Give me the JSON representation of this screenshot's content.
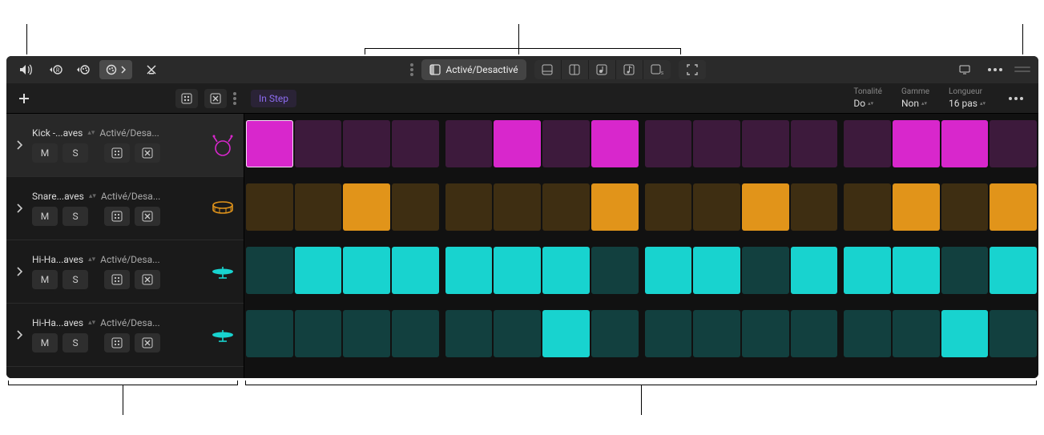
{
  "toolbar": {
    "edit_toggle_label": "Activé/Desactivé"
  },
  "subbar": {
    "in_step_label": "In Step",
    "params": [
      {
        "label": "Tonalité",
        "value": "Do"
      },
      {
        "label": "Gamme",
        "value": "Non"
      },
      {
        "label": "Longueur",
        "value": "16 pas"
      }
    ]
  },
  "track_common": {
    "mute_label": "M",
    "solo_label": "S",
    "status_label": "Activé/Desa..."
  },
  "tracks": [
    {
      "name": "Kick -...aves",
      "icon": "kick",
      "color_on": "#d827cc",
      "color_off": "#3d1a3c"
    },
    {
      "name": "Snare...aves",
      "icon": "snare",
      "color_on": "#e1941a",
      "color_off": "#3e2e12"
    },
    {
      "name": "Hi-Ha...aves",
      "icon": "hihat",
      "color_on": "#18d3cf",
      "color_off": "#12403f"
    },
    {
      "name": "Hi-Ha...aves",
      "icon": "hihat",
      "color_on": "#18d3cf",
      "color_off": "#12403f"
    }
  ],
  "chart_data": {
    "type": "table",
    "steps": 16,
    "rows": [
      {
        "track": "Kick",
        "pattern": [
          1,
          0,
          0,
          0,
          0,
          1,
          0,
          1,
          0,
          0,
          0,
          0,
          0,
          1,
          1,
          0
        ]
      },
      {
        "track": "Snare",
        "pattern": [
          0,
          0,
          1,
          0,
          0,
          0,
          0,
          1,
          0,
          0,
          1,
          0,
          0,
          1,
          0,
          1
        ]
      },
      {
        "track": "Hi-Hat",
        "pattern": [
          0,
          1,
          1,
          1,
          1,
          1,
          1,
          0,
          1,
          1,
          0,
          1,
          1,
          1,
          0,
          1
        ]
      },
      {
        "track": "Hi-Hat open",
        "pattern": [
          0,
          0,
          0,
          0,
          0,
          0,
          1,
          0,
          0,
          0,
          0,
          0,
          0,
          0,
          1,
          0
        ]
      }
    ],
    "selected": {
      "row": 0,
      "step": 0
    }
  }
}
